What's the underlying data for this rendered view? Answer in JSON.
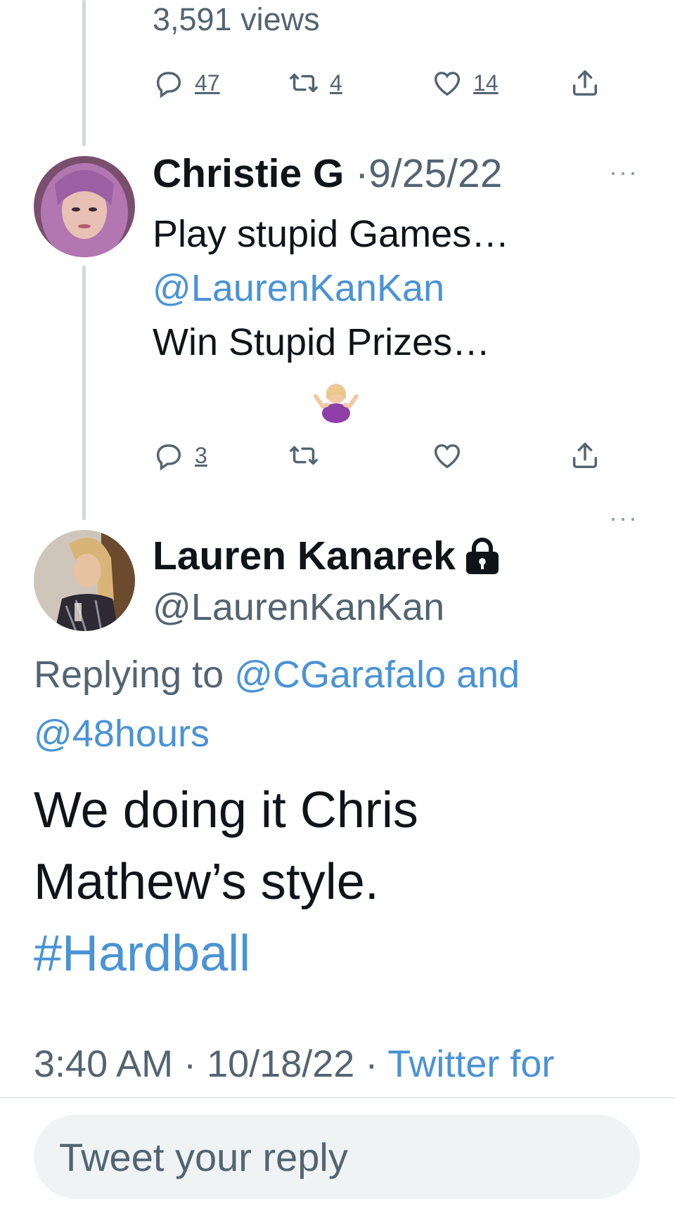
{
  "previous_tweet": {
    "views": "3,591 views",
    "actions": {
      "replies": "47",
      "retweets": "4",
      "likes": "14"
    }
  },
  "reply_tweet": {
    "author_name": "Christie G",
    "separator": "·",
    "date": "9/25/22",
    "more": "···",
    "lines": [
      "Play stupid Games…",
      "@LaurenKanKan",
      "Win Stupid Prizes…"
    ],
    "emoji": "woman-shrugging-emoji",
    "actions": {
      "replies": "3"
    }
  },
  "main_tweet": {
    "author_name": "Lauren Kanarek",
    "lock_icon": "lock-icon",
    "handle": "@LaurenKanKan",
    "more": "···",
    "replying_prefix": "Replying to",
    "replying_line1": "@CGarafalo and",
    "replying_line2": "@48hours",
    "text_line1": "We doing it Chris",
    "text_line2": "Mathew’s style.",
    "hashtag": "#Hardball",
    "time": "3:40 AM",
    "separator": "·",
    "date": "10/18/22",
    "source": "Twitter for"
  },
  "reply_input": {
    "placeholder": "Tweet your reply"
  },
  "colors": {
    "link": "#4a93d6",
    "secondary_text": "#536471",
    "thread_line": "#cfd9de",
    "input_bg": "#eff3f4"
  }
}
